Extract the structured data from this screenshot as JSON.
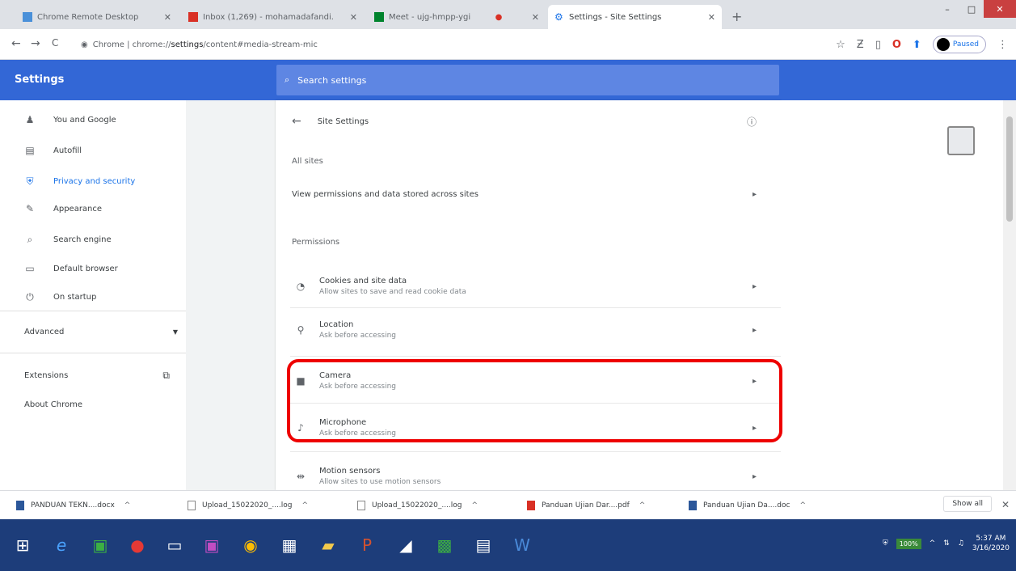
{
  "tabs": [
    {
      "title": "Chrome Remote Desktop",
      "color": "#4a90d9"
    },
    {
      "title": "Inbox (1,269) - mohamadafandi.",
      "color": "#d93025"
    },
    {
      "title": "Meet - ujg-hmpp-ygi",
      "color": "#00832d"
    },
    {
      "title": "Settings - Site Settings",
      "color": "#1a73e8"
    }
  ],
  "new_tab": "+",
  "window_controls": {
    "min": "–",
    "max": "□",
    "close": "✕"
  },
  "toolbar": {
    "back": "←",
    "forward": "→",
    "reload": "C",
    "url_prefix": "Chrome | chrome://",
    "url_bold": "settings",
    "url_rest": "/content#media-stream-mic",
    "paused": "Paused"
  },
  "header": {
    "title": "Settings",
    "search_placeholder": "Search settings"
  },
  "sidebar": {
    "items": [
      {
        "label": "You and Google",
        "icon": "person-icon",
        "glyph": "⚲"
      },
      {
        "label": "Autofill",
        "icon": "clipboard-icon",
        "glyph": "▤"
      },
      {
        "label": "Privacy and security",
        "icon": "shield-icon",
        "glyph": "⛨"
      },
      {
        "label": "Appearance",
        "icon": "palette-icon",
        "glyph": "✎"
      },
      {
        "label": "Search engine",
        "icon": "search-icon",
        "glyph": "⌕"
      },
      {
        "label": "Default browser",
        "icon": "browser-icon",
        "glyph": "▭"
      },
      {
        "label": "On startup",
        "icon": "power-icon",
        "glyph": "⏻"
      }
    ],
    "advanced": "Advanced",
    "extensions": "Extensions",
    "about": "About Chrome"
  },
  "site_settings": {
    "title": "Site Settings",
    "all_sites_heading": "All sites",
    "all_sites_link": "View permissions and data stored across sites",
    "permissions_heading": "Permissions",
    "rows": [
      {
        "title": "Cookies and site data",
        "sub": "Allow sites to save and read cookie data",
        "icon": "cookie-icon",
        "glyph": "◔"
      },
      {
        "title": "Location",
        "sub": "Ask before accessing",
        "icon": "location-icon",
        "glyph": "⚲"
      },
      {
        "title": "Camera",
        "sub": "Ask before accessing",
        "icon": "camera-icon",
        "glyph": "■"
      },
      {
        "title": "Microphone",
        "sub": "Ask before accessing",
        "icon": "microphone-icon",
        "glyph": "♪"
      },
      {
        "title": "Motion sensors",
        "sub": "Allow sites to use motion sensors",
        "icon": "motion-sensor-icon",
        "glyph": "⇹"
      }
    ]
  },
  "downloads": {
    "items": [
      {
        "name": "PANDUAN TEKN....docx",
        "color": "#2b579a"
      },
      {
        "name": "Upload_15022020_....log",
        "color": "#888888"
      },
      {
        "name": "Upload_15022020_....log",
        "color": "#888888"
      },
      {
        "name": "Panduan Ujian Dar....pdf",
        "color": "#d93025"
      },
      {
        "name": "Panduan Ujian Da....doc",
        "color": "#2b579a"
      }
    ],
    "show_all": "Show all"
  },
  "taskbar": {
    "battery": "100%",
    "time": "5:37 AM",
    "date": "3/16/2020"
  }
}
